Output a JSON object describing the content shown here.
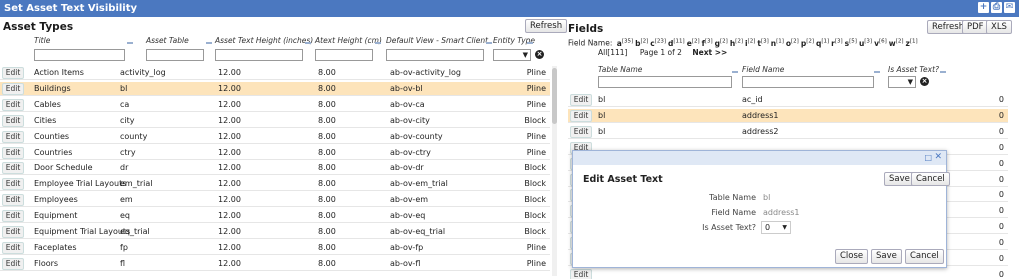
{
  "window": {
    "title": "Set Asset Text Visibility"
  },
  "left": {
    "heading": "Asset Types",
    "refresh_label": "Refresh",
    "columns": [
      "Title",
      "Asset Table",
      "Asset Text Height (inches)",
      "Atext Height (cm)",
      "Default View - Smart Client",
      "Entity Type"
    ],
    "edit_label": "Edit",
    "rows": [
      [
        "Action Items",
        "activity_log",
        "12.00",
        "8.00",
        "ab-ov-activity_log",
        "Pline"
      ],
      [
        "Buildings",
        "bl",
        "12.00",
        "8.00",
        "ab-ov-bl",
        "Pline"
      ],
      [
        "Cables",
        "ca",
        "12.00",
        "8.00",
        "ab-ov-ca",
        "Pline"
      ],
      [
        "Cities",
        "city",
        "12.00",
        "8.00",
        "ab-ov-city",
        "Block"
      ],
      [
        "Counties",
        "county",
        "12.00",
        "8.00",
        "ab-ov-county",
        "Pline"
      ],
      [
        "Countries",
        "ctry",
        "12.00",
        "8.00",
        "ab-ov-ctry",
        "Pline"
      ],
      [
        "Door Schedule",
        "dr",
        "12.00",
        "8.00",
        "ab-ov-dr",
        "Block"
      ],
      [
        "Employee Trial Layouts",
        "em_trial",
        "12.00",
        "8.00",
        "ab-ov-em_trial",
        "Block"
      ],
      [
        "Employees",
        "em",
        "12.00",
        "8.00",
        "ab-ov-em",
        "Block"
      ],
      [
        "Equipment",
        "eq",
        "12.00",
        "8.00",
        "ab-ov-eq",
        "Block"
      ],
      [
        "Equipment Trial Layouts",
        "eq_trial",
        "12.00",
        "8.00",
        "ab-ov-eq_trial",
        "Block"
      ],
      [
        "Faceplates",
        "fp",
        "12.00",
        "8.00",
        "ab-ov-fp",
        "Pline"
      ],
      [
        "Floors",
        "fl",
        "12.00",
        "8.00",
        "ab-ov-fl",
        "Pline"
      ]
    ]
  },
  "right": {
    "heading": "Fields",
    "refresh_label": "Refresh",
    "pdf_label": "PDF",
    "xls_label": "XLS",
    "field_name_label": "Field Name:",
    "letters": [
      {
        "l": "a",
        "c": "[35]"
      },
      {
        "l": "b",
        "c": "[2]"
      },
      {
        "l": "c",
        "c": "[23]"
      },
      {
        "l": "d",
        "c": "[11]"
      },
      {
        "l": "e",
        "c": "[2]"
      },
      {
        "l": "f",
        "c": "[3]"
      },
      {
        "l": "g",
        "c": "[2]"
      },
      {
        "l": "h",
        "c": "[2]"
      },
      {
        "l": "i",
        "c": "[2]"
      },
      {
        "l": "t",
        "c": "[3]"
      },
      {
        "l": "n",
        "c": "[1]"
      },
      {
        "l": "o",
        "c": "[2]"
      },
      {
        "l": "p",
        "c": "[2]"
      },
      {
        "l": "q",
        "c": "[1]"
      },
      {
        "l": "r",
        "c": "[3]"
      },
      {
        "l": "s",
        "c": "[5]"
      },
      {
        "l": "u",
        "c": "[3]"
      },
      {
        "l": "v",
        "c": "[6]"
      },
      {
        "l": "w",
        "c": "[2]"
      },
      {
        "l": "z",
        "c": "[1]"
      }
    ],
    "all_label": "All[111]",
    "page_label": "Page 1 of 2",
    "next_label": "Next >>",
    "columns": [
      "Table Name",
      "Field Name",
      "Is Asset Text?"
    ],
    "edit_label": "Edit",
    "rows": [
      [
        "bl",
        "ac_id",
        "0"
      ],
      [
        "bl",
        "address1",
        "0"
      ],
      [
        "bl",
        "address2",
        "0"
      ],
      [
        "",
        "",
        "0"
      ],
      [
        "",
        "",
        "0"
      ],
      [
        "",
        "",
        "0"
      ],
      [
        "",
        "",
        "0"
      ],
      [
        "",
        "",
        "0"
      ],
      [
        "",
        "",
        "0"
      ],
      [
        "",
        "",
        "0"
      ],
      [
        "",
        "",
        "0"
      ],
      [
        "",
        "",
        "0"
      ]
    ]
  },
  "dialog": {
    "title": "Edit Asset Text",
    "save_label": "Save",
    "cancel_label": "Cancel",
    "table_name_label": "Table Name",
    "table_name_value": "bl",
    "field_name_label": "Field Name",
    "field_name_value": "address1",
    "is_asset_label": "Is Asset Text?",
    "is_asset_value": "0",
    "close_label": "Close",
    "save2_label": "Save",
    "cancel2_label": "Cancel"
  },
  "colors": {
    "titlebar": "#4b78c0",
    "selected_row": "#fde4bb"
  }
}
